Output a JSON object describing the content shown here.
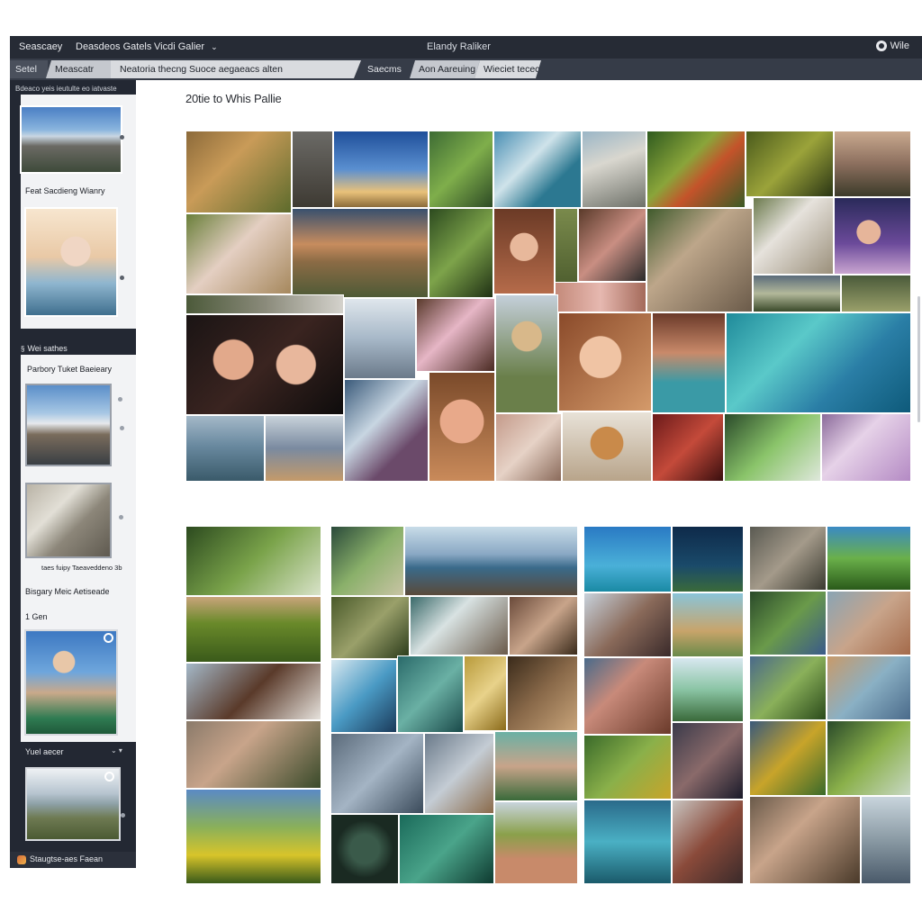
{
  "menubar": {
    "items": [
      "Seascaey",
      "Deasdeos Gatels",
      "Vicdi Galier"
    ],
    "app_title": "Elandy Raliker",
    "account_label": "Wile"
  },
  "tabs": [
    "Setel",
    "Meascatr",
    "Neatoria thecng Suoce aegaeacs alten",
    "Saecms",
    "Aon Aareuing",
    "Wieciet tecec"
  ],
  "sidebar": {
    "header": "Bdeaco yeis ieutulte eo iatvaste",
    "caption_1": "Feat Sacdieng Wianry",
    "section_title": "Wei sathes",
    "caption_2": "Parbory Tuket Baeieary",
    "caption_3": "taes fuipy Taeaveddeno 3b",
    "caption_4": "Bisgary Meic Aetiseade",
    "caption_5": "1 Gen",
    "caption_6": "Yuel aecer",
    "footer": "Staugtse-aes Faean"
  },
  "main": {
    "page_title": "20tie to Whis Pallie"
  },
  "colors": {
    "menubar_bg": "#262b35",
    "tabbar_bg": "#363c48",
    "sidebar_bg": "#232833"
  },
  "icons": {
    "account": "account-icon",
    "menu_dropdown": "chevron-down-icon",
    "thumbnail_option": "ring-icon"
  }
}
